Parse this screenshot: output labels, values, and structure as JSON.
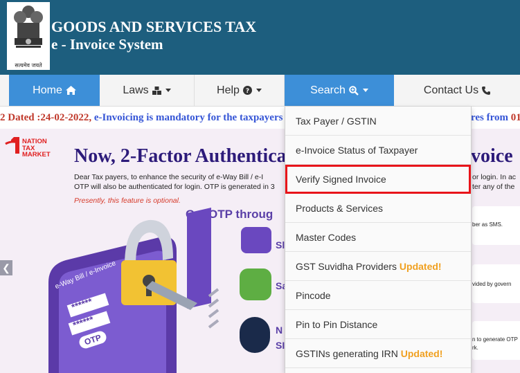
{
  "header": {
    "title": "GOODS AND SERVICES TAX",
    "subtitle": "e - Invoice System",
    "emblem_motto": "सत्यमेव जयते"
  },
  "nav": {
    "home": "Home",
    "laws": "Laws",
    "help": "Help",
    "search": "Search",
    "contact": "Contact Us",
    "active_color": "#3d8fd8"
  },
  "ticker": {
    "text1": "2 Dated :24-02-2022,",
    "text2": " e-Invoicing is mandatory for the taxpayers",
    "text3": "res from",
    "text4": " 01"
  },
  "banner": {
    "logo_text": "NATION TAX MARKET",
    "headline": "Now, 2-Factor Authenticat",
    "headline_right": "voice",
    "para_line1": "Dear Tax payers, to enhance the security of e-Way Bill / e-I",
    "para_line2": "OTP will also be authenticated for login. OTP is generated in 3",
    "para_line3": "Presently, this feature is optional.",
    "para_right1": "or login. In ac",
    "para_right2": "ter any of the",
    "otp_heading": "Get OTP throug",
    "option_sms": "Sl",
    "option_sandes": "Sa",
    "option_nic1": "N",
    "option_nic2": "SI",
    "card1_text": "ber as SMS.",
    "card2_text": "vided by govern",
    "card3_text1": "n to generate OTP",
    "card3_text2": "rk.",
    "laptop_label": "e-Way Bill / e-Invoice",
    "pwd1": "******",
    "pwd2": "******",
    "otp_button": "OTP",
    "prev_arrow": "❮"
  },
  "search_menu": {
    "items": [
      {
        "label": "Tax Payer / GSTIN",
        "badge": ""
      },
      {
        "label": "e-Invoice Status of Taxpayer",
        "badge": ""
      },
      {
        "label": "Verify Signed Invoice",
        "badge": ""
      },
      {
        "label": "Products & Services",
        "badge": ""
      },
      {
        "label": "Master Codes",
        "badge": ""
      },
      {
        "label": "GST Suvidha Providers ",
        "badge": "Updated!"
      },
      {
        "label": "Pincode",
        "badge": ""
      },
      {
        "label": "Pin to Pin Distance",
        "badge": ""
      },
      {
        "label": "GSTINs generating IRN ",
        "badge": "Updated!"
      }
    ],
    "highlight_color": "#e8141a",
    "badge_color": "#f0a020"
  }
}
